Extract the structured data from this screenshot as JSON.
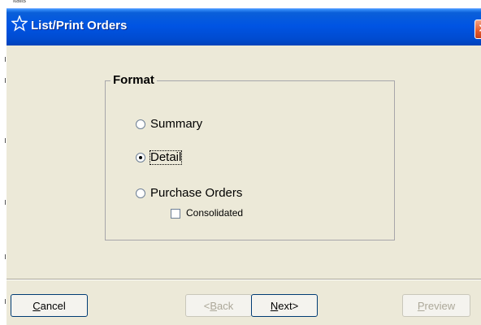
{
  "window": {
    "title": "List/Print Orders",
    "close_glyph": "✕"
  },
  "format_group": {
    "legend": "Format",
    "options": [
      {
        "label": "Summary",
        "checked": false
      },
      {
        "label": "Detail",
        "checked": true
      },
      {
        "label": "Purchase Orders",
        "checked": false
      }
    ],
    "consolidated": {
      "label": "Consolidated",
      "checked": false
    }
  },
  "buttons": {
    "cancel": {
      "mnemonic": "C",
      "rest": "ancel"
    },
    "back": {
      "arrow": "< ",
      "mnemonic": "B",
      "rest": "ack",
      "enabled": false
    },
    "next": {
      "mnemonic": "N",
      "rest": "ext",
      "arrow": " >"
    },
    "preview": {
      "mnemonic": "P",
      "rest": "review",
      "enabled": false
    }
  },
  "colors": {
    "titlebar": "#0054e3",
    "dialog_bg": "#ece9d8",
    "close_button": "#e35a2a"
  },
  "icons": {
    "title_icon": "star-outline-icon",
    "close_icon": "close-icon"
  }
}
